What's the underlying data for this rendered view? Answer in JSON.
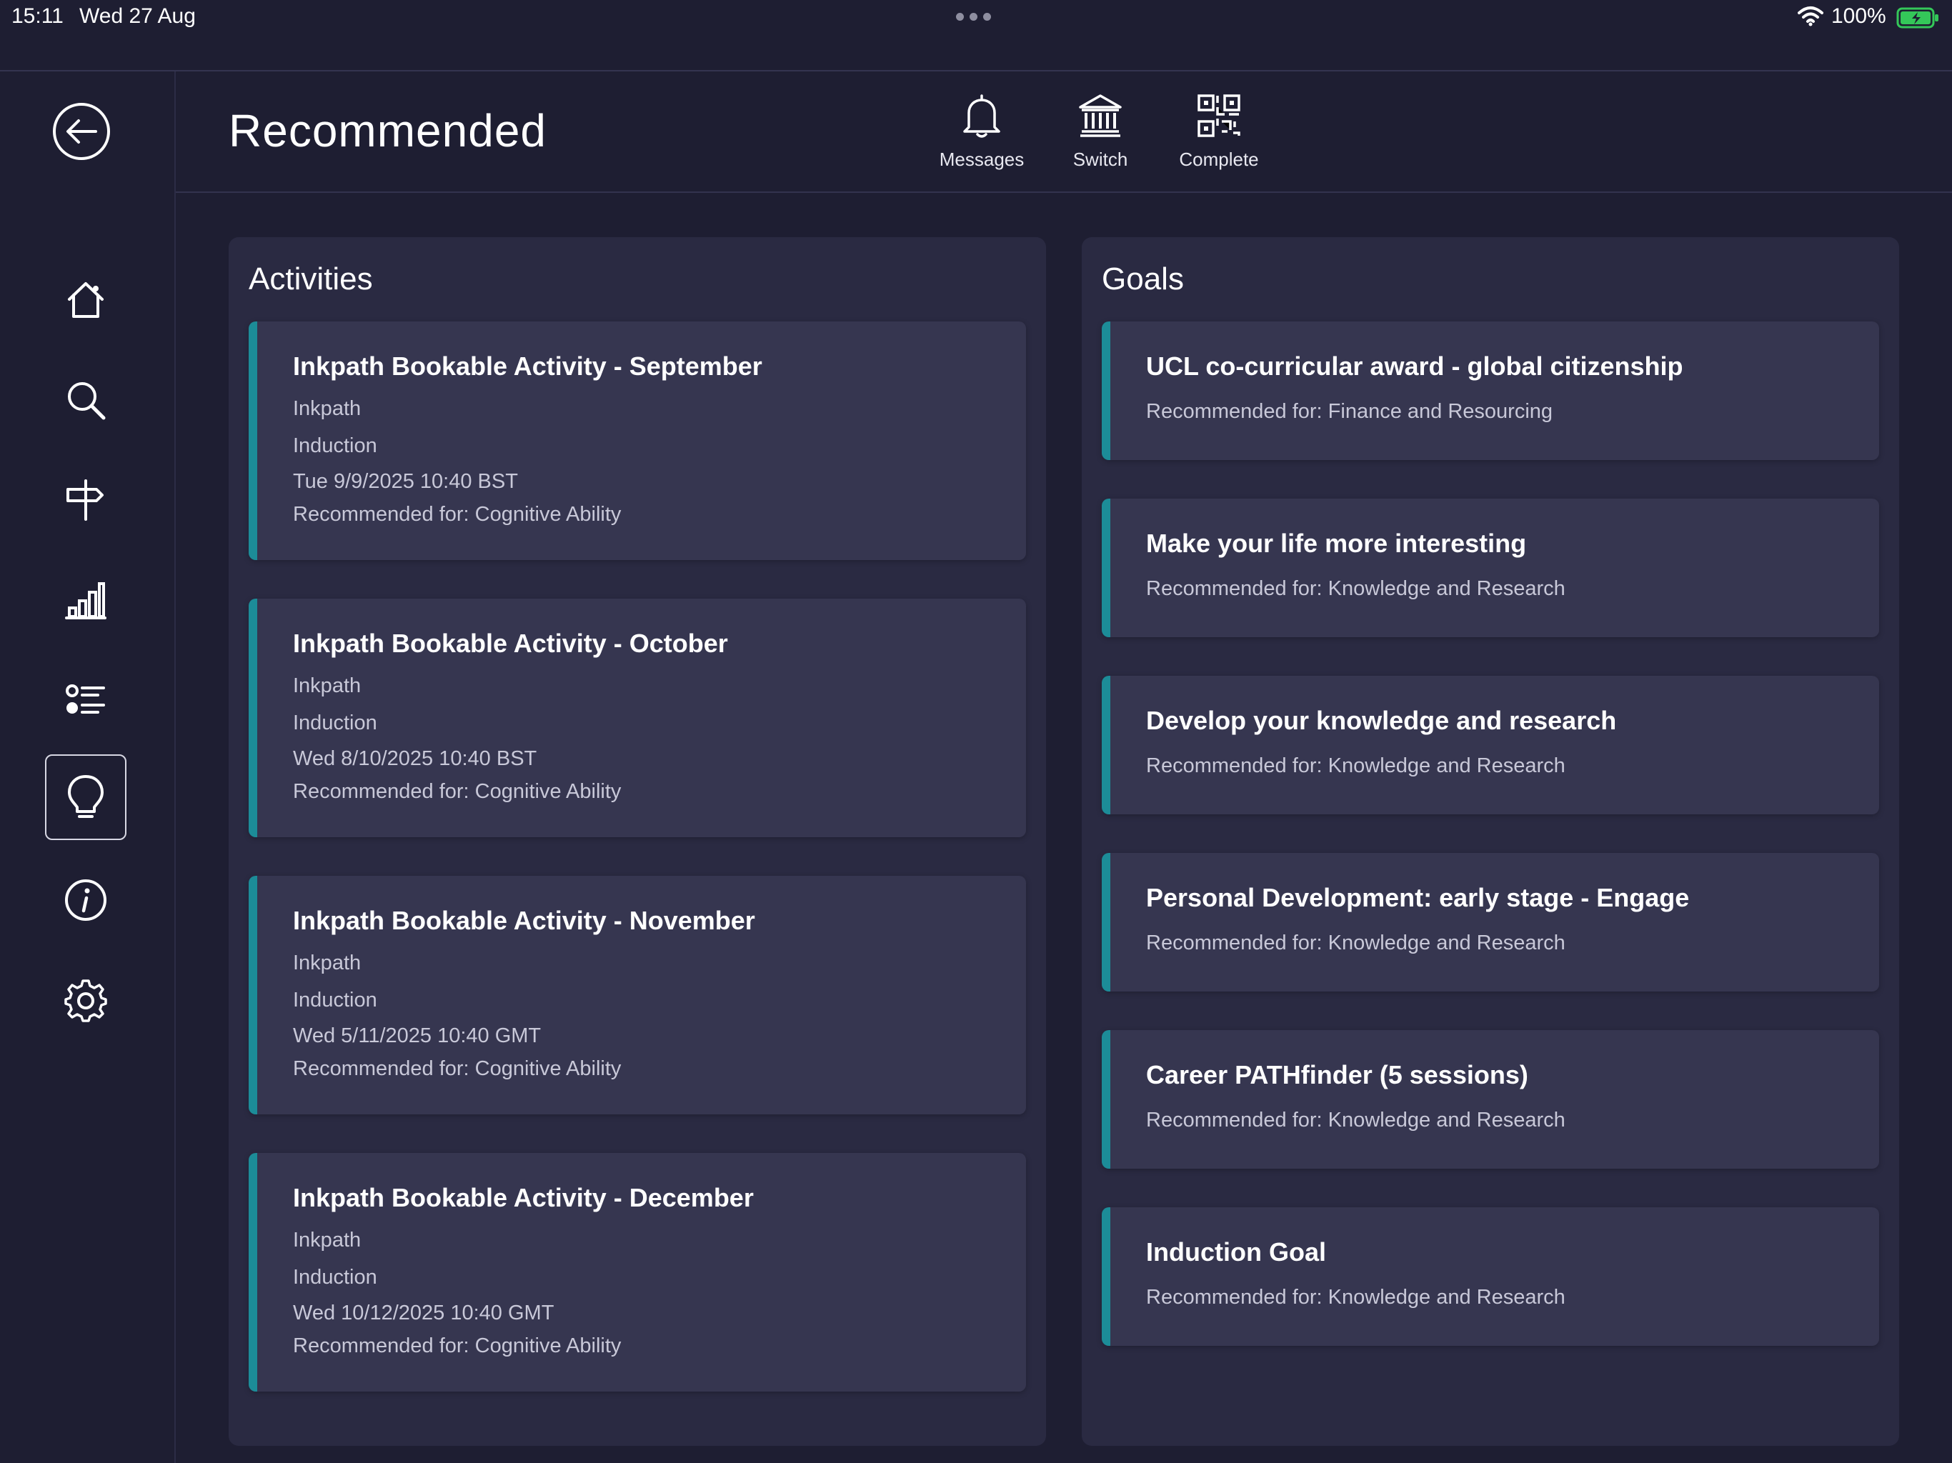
{
  "status_bar": {
    "time": "15:11",
    "date": "Wed 27 Aug",
    "battery": "100%"
  },
  "header": {
    "title": "Recommended",
    "actions": [
      {
        "label": "Messages",
        "icon": "bell-icon"
      },
      {
        "label": "Switch",
        "icon": "institution-icon"
      },
      {
        "label": "Complete",
        "icon": "qr-code-icon"
      }
    ]
  },
  "sidebar": {
    "items": [
      {
        "icon": "home-icon"
      },
      {
        "icon": "search-icon"
      },
      {
        "icon": "signpost-icon"
      },
      {
        "icon": "bar-chart-icon"
      },
      {
        "icon": "list-icon"
      },
      {
        "icon": "lightbulb-icon",
        "active": true
      },
      {
        "icon": "info-icon"
      },
      {
        "icon": "settings-icon"
      }
    ]
  },
  "activities": {
    "title": "Activities",
    "items": [
      {
        "title": "Inkpath Bookable Activity - September",
        "provider": "Inkpath",
        "category": "Induction",
        "datetime": "Tue 9/9/2025 10:40 BST",
        "recommended": "Recommended for: Cognitive Ability"
      },
      {
        "title": "Inkpath Bookable Activity - October",
        "provider": "Inkpath",
        "category": "Induction",
        "datetime": "Wed 8/10/2025 10:40 BST",
        "recommended": "Recommended for: Cognitive Ability"
      },
      {
        "title": "Inkpath Bookable Activity - November",
        "provider": "Inkpath",
        "category": "Induction",
        "datetime": "Wed 5/11/2025 10:40 GMT",
        "recommended": "Recommended for: Cognitive Ability"
      },
      {
        "title": "Inkpath Bookable Activity - December",
        "provider": "Inkpath",
        "category": "Induction",
        "datetime": "Wed 10/12/2025 10:40 GMT",
        "recommended": "Recommended for: Cognitive Ability"
      }
    ]
  },
  "goals": {
    "title": "Goals",
    "items": [
      {
        "title": "UCL co-curricular award - global citizenship",
        "recommended": "Recommended for: Finance and Resourcing"
      },
      {
        "title": "Make your life more interesting",
        "recommended": "Recommended for: Knowledge and Research"
      },
      {
        "title": "Develop your knowledge and research",
        "recommended": "Recommended for: Knowledge and Research"
      },
      {
        "title": "Personal Development: early stage - Engage",
        "recommended": "Recommended for: Knowledge and Research"
      },
      {
        "title": "Career PATHfinder (5 sessions)",
        "recommended": "Recommended for: Knowledge and Research"
      },
      {
        "title": "Induction Goal",
        "recommended": "Recommended for: Knowledge and Research"
      }
    ]
  },
  "colors": {
    "background": "#1e1e32",
    "panel": "#2a2a42",
    "card": "#363650",
    "accent": "#1c8c98",
    "battery": "#34c759"
  }
}
